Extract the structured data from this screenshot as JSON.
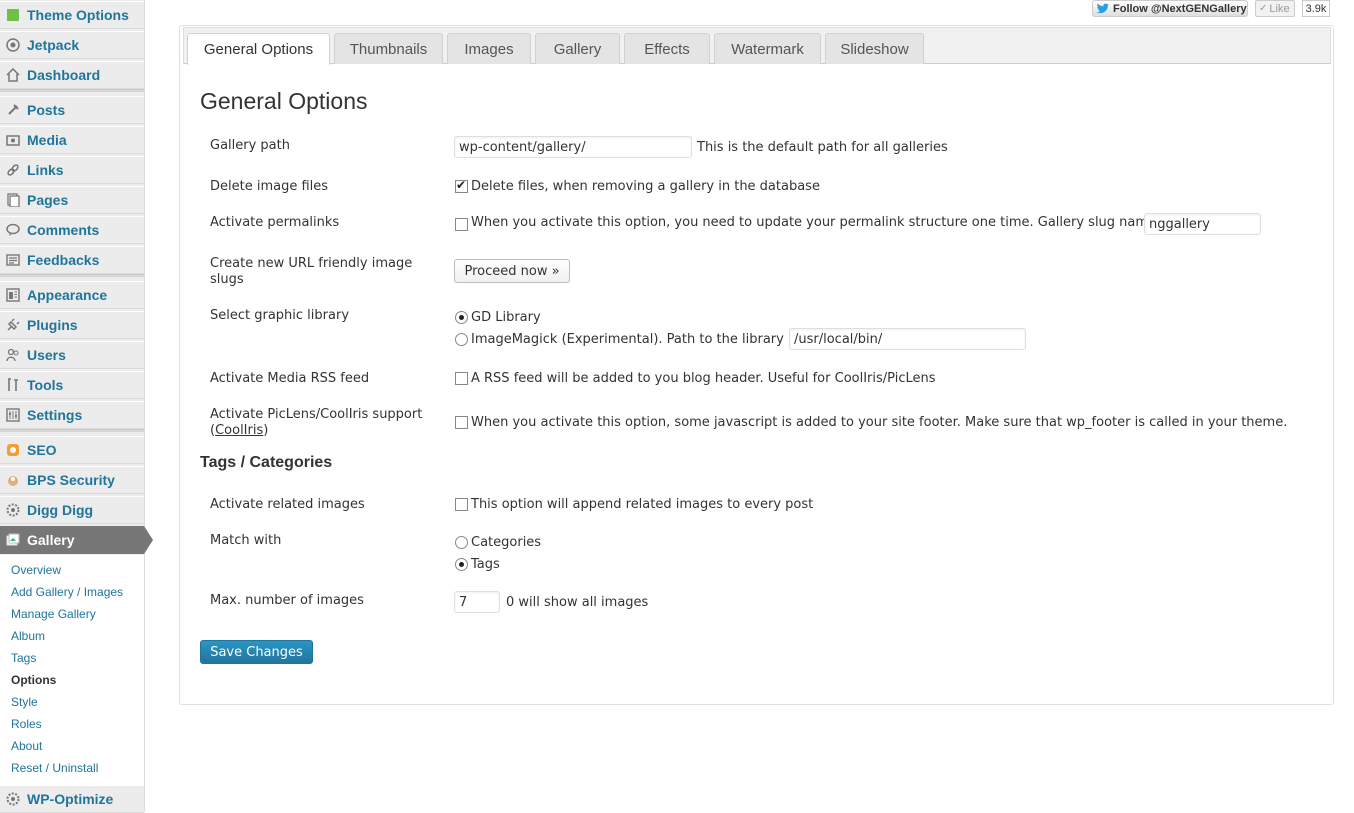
{
  "sidebar": {
    "items": [
      {
        "label": "Theme Options",
        "icon": "theme-options-icon"
      },
      {
        "label": "Jetpack",
        "icon": "jetpack-icon"
      },
      {
        "label": "Dashboard",
        "icon": "dashboard-icon"
      },
      {
        "label": "Posts",
        "icon": "posts-icon"
      },
      {
        "label": "Media",
        "icon": "media-icon"
      },
      {
        "label": "Links",
        "icon": "links-icon"
      },
      {
        "label": "Pages",
        "icon": "pages-icon"
      },
      {
        "label": "Comments",
        "icon": "comments-icon"
      },
      {
        "label": "Feedbacks",
        "icon": "feedbacks-icon"
      },
      {
        "label": "Appearance",
        "icon": "appearance-icon"
      },
      {
        "label": "Plugins",
        "icon": "plugins-icon"
      },
      {
        "label": "Users",
        "icon": "users-icon"
      },
      {
        "label": "Tools",
        "icon": "tools-icon"
      },
      {
        "label": "Settings",
        "icon": "settings-icon"
      },
      {
        "label": "SEO",
        "icon": "seo-icon"
      },
      {
        "label": "BPS Security",
        "icon": "bps-security-icon"
      },
      {
        "label": "Digg Digg",
        "icon": "digg-digg-icon"
      },
      {
        "label": "Gallery",
        "icon": "gallery-icon"
      },
      {
        "label": "WP-Optimize",
        "icon": "wp-optimize-icon"
      }
    ],
    "submenu": [
      {
        "label": "Overview"
      },
      {
        "label": "Add Gallery / Images"
      },
      {
        "label": "Manage Gallery"
      },
      {
        "label": "Album"
      },
      {
        "label": "Tags"
      },
      {
        "label": "Options"
      },
      {
        "label": "Style"
      },
      {
        "label": "Roles"
      },
      {
        "label": "About"
      },
      {
        "label": "Reset / Uninstall"
      }
    ]
  },
  "social": {
    "follow_label": "Follow @NextGENGallery",
    "like_label": "Like",
    "like_count": "3.9k"
  },
  "tabs": [
    "General Options",
    "Thumbnails",
    "Images",
    "Gallery",
    "Effects",
    "Watermark",
    "Slideshow"
  ],
  "main": {
    "title": "General Options",
    "gallery_path_label": "Gallery path",
    "gallery_path_value": "wp-content/gallery/",
    "gallery_path_hint": "This is the default path for all galleries",
    "delete_label": "Delete image files",
    "delete_text": "Delete files, when removing a gallery in the database",
    "permalinks_label": "Activate permalinks",
    "permalinks_text": "When you activate this option, you need to update your permalink structure one time. Gallery slug name :",
    "slug_value": "nggallery",
    "slugs_label": "Create new URL friendly image slugs",
    "proceed_label": "Proceed now »",
    "graphic_label": "Select graphic library",
    "gd_label": "GD Library",
    "imagick_label": "ImageMagick (Experimental). Path to the library :",
    "imagick_path": "/usr/local/bin/",
    "rss_label": "Activate Media RSS feed",
    "rss_text": "A RSS feed will be added to you blog header. Useful for CoolIris/PicLens",
    "piclens_label": "Activate PicLens/CoolIris support",
    "piclens_label_open": "(",
    "piclens_link": "CoolIris",
    "piclens_label_close": ")",
    "piclens_text": "When you activate this option, some javascript is added to your site footer. Make sure that wp_footer is called in your theme.",
    "tags_heading": "Tags / Categories",
    "related_label": "Activate related images",
    "related_text": "This option will append related images to every post",
    "match_label": "Match with",
    "match_categories": "Categories",
    "match_tags": "Tags",
    "max_label": "Max. number of images",
    "max_value": "7",
    "max_hint": "0 will show all images",
    "save_label": "Save Changes"
  },
  "colors": {
    "link": "#21759b",
    "current_menu": "#777777"
  }
}
